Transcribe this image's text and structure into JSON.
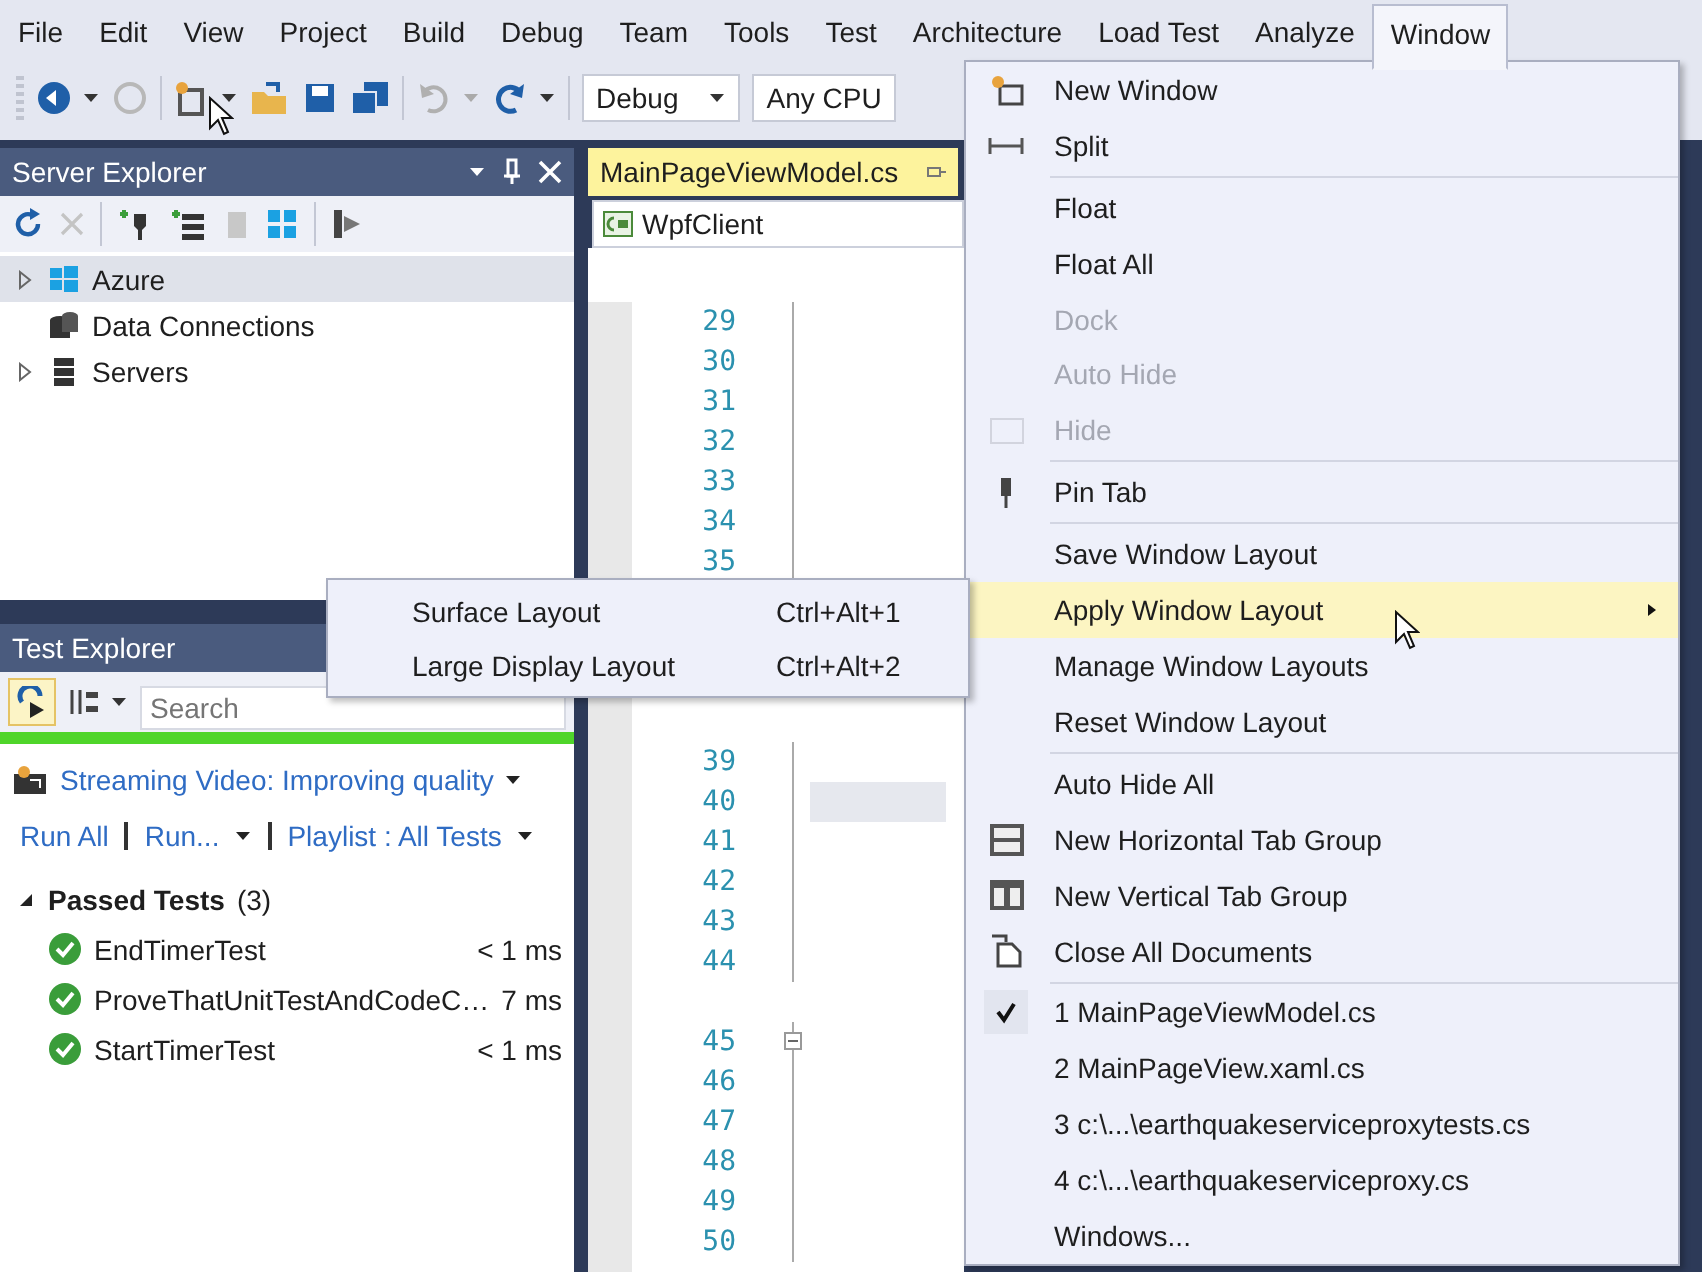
{
  "menubar": [
    {
      "label": "File",
      "selected": false
    },
    {
      "label": "Edit",
      "selected": false
    },
    {
      "label": "View",
      "selected": false
    },
    {
      "label": "Project",
      "selected": false
    },
    {
      "label": "Build",
      "selected": false
    },
    {
      "label": "Debug",
      "selected": false
    },
    {
      "label": "Team",
      "selected": false
    },
    {
      "label": "Tools",
      "selected": false
    },
    {
      "label": "Test",
      "selected": false
    },
    {
      "label": "Architecture",
      "selected": false
    },
    {
      "label": "Load Test",
      "selected": false
    },
    {
      "label": "Analyze",
      "selected": false
    },
    {
      "label": "Window",
      "selected": true
    }
  ],
  "toolbar": {
    "configuration": "Debug",
    "platform": "Any CPU"
  },
  "server_explorer": {
    "title": "Server Explorer",
    "tree": [
      {
        "label": "Azure",
        "kind": "azure",
        "has_children": true,
        "expanded": false,
        "selected": true
      },
      {
        "label": "Data Connections",
        "kind": "database",
        "has_children": false,
        "expanded": false,
        "selected": false
      },
      {
        "label": "Servers",
        "kind": "servers",
        "has_children": true,
        "expanded": false,
        "selected": false
      }
    ]
  },
  "test_explorer": {
    "title": "Test Explorer",
    "search": {
      "placeholder": "Search"
    },
    "progress": {
      "level": 1
    },
    "playlist": "Streaming Video: Improving quality",
    "links": [
      {
        "label": "Run All",
        "dropdown": false
      },
      {
        "label": "Run...",
        "dropdown": true
      },
      {
        "label": "Playlist : All Tests",
        "dropdown": true
      }
    ],
    "group": {
      "label": "Passed Tests",
      "count": "(3)",
      "expanded": true
    },
    "tests": [
      {
        "name": "EndTimerTest",
        "duration": "< 1 ms"
      },
      {
        "name": "ProveThatUnitTestAndCodeC…",
        "duration": "7 ms"
      },
      {
        "name": "StartTimerTest",
        "duration": "< 1 ms"
      }
    ]
  },
  "editor": {
    "tab": "MainPageViewModel.cs",
    "project": "WpfClient",
    "lines": [
      {
        "kind": "line",
        "number": "29",
        "fold": false,
        "highlighted": false
      },
      {
        "kind": "line",
        "number": "30",
        "fold": false,
        "highlighted": false
      },
      {
        "kind": "line",
        "number": "31",
        "fold": false,
        "highlighted": false
      },
      {
        "kind": "line",
        "number": "32",
        "fold": false,
        "highlighted": false
      },
      {
        "kind": "line",
        "number": "33",
        "fold": false,
        "highlighted": false
      },
      {
        "kind": "line",
        "number": "34",
        "fold": false,
        "highlighted": false
      },
      {
        "kind": "line",
        "number": "35",
        "fold": false,
        "highlighted": false
      },
      {
        "kind": "spacer"
      },
      {
        "kind": "spacer"
      },
      {
        "kind": "spacer"
      },
      {
        "kind": "spacer"
      },
      {
        "kind": "line",
        "number": "39",
        "fold": false,
        "highlighted": false
      },
      {
        "kind": "line",
        "number": "40",
        "fold": false,
        "highlighted": true
      },
      {
        "kind": "line",
        "number": "41",
        "fold": false,
        "highlighted": false
      },
      {
        "kind": "line",
        "number": "42",
        "fold": false,
        "highlighted": false
      },
      {
        "kind": "line",
        "number": "43",
        "fold": false,
        "highlighted": false
      },
      {
        "kind": "line",
        "number": "44",
        "fold": false,
        "highlighted": false
      },
      {
        "kind": "spacer"
      },
      {
        "kind": "line",
        "number": "45",
        "fold": true,
        "highlighted": false
      },
      {
        "kind": "line",
        "number": "46",
        "fold": false,
        "highlighted": false
      },
      {
        "kind": "line",
        "number": "47",
        "fold": false,
        "highlighted": false
      },
      {
        "kind": "line",
        "number": "48",
        "fold": false,
        "highlighted": false
      },
      {
        "kind": "line",
        "number": "49",
        "fold": false,
        "highlighted": false
      },
      {
        "kind": "line",
        "number": "50",
        "fold": false,
        "highlighted": false
      }
    ]
  },
  "window_menu": {
    "groups": [
      [
        {
          "label": "New Window",
          "kind": "new-window",
          "disabled": false,
          "checked": false,
          "highlighted": false,
          "submenu": false
        },
        {
          "label": "Split",
          "kind": "split",
          "disabled": false,
          "checked": false,
          "highlighted": false,
          "submenu": false
        }
      ],
      [
        {
          "label": "Float",
          "kind": "plain",
          "disabled": false,
          "checked": false,
          "highlighted": false,
          "submenu": false
        },
        {
          "label": "Float All",
          "kind": "plain",
          "disabled": false,
          "checked": false,
          "highlighted": false,
          "submenu": false
        },
        {
          "label": "Dock",
          "kind": "plain",
          "disabled": true,
          "checked": false,
          "highlighted": false,
          "submenu": false
        },
        {
          "label": "Auto Hide",
          "kind": "plain",
          "disabled": true,
          "checked": false,
          "highlighted": false,
          "submenu": false
        },
        {
          "label": "Hide",
          "kind": "hide",
          "disabled": true,
          "checked": false,
          "highlighted": false,
          "submenu": false
        }
      ],
      [
        {
          "label": "Pin Tab",
          "kind": "pin",
          "disabled": false,
          "checked": false,
          "highlighted": false,
          "submenu": false
        }
      ],
      [
        {
          "label": "Save Window Layout",
          "kind": "plain",
          "disabled": false,
          "checked": false,
          "highlighted": false,
          "submenu": false
        },
        {
          "label": "Apply Window Layout",
          "kind": "plain",
          "disabled": false,
          "checked": false,
          "highlighted": true,
          "submenu": true
        },
        {
          "label": "Manage Window Layouts",
          "kind": "plain",
          "disabled": false,
          "checked": false,
          "highlighted": false,
          "submenu": false
        },
        {
          "label": "Reset Window Layout",
          "kind": "plain",
          "disabled": false,
          "checked": false,
          "highlighted": false,
          "submenu": false
        }
      ],
      [
        {
          "label": "Auto Hide All",
          "kind": "plain",
          "disabled": false,
          "checked": false,
          "highlighted": false,
          "submenu": false
        },
        {
          "label": "New Horizontal Tab Group",
          "kind": "horizontal-group",
          "disabled": false,
          "checked": false,
          "highlighted": false,
          "submenu": false
        },
        {
          "label": "New Vertical Tab Group",
          "kind": "vertical-group",
          "disabled": false,
          "checked": false,
          "highlighted": false,
          "submenu": false
        },
        {
          "label": "Close All Documents",
          "kind": "close-all",
          "disabled": false,
          "checked": false,
          "highlighted": false,
          "submenu": false
        }
      ],
      [
        {
          "label": "1 MainPageViewModel.cs",
          "kind": "plain",
          "disabled": false,
          "checked": true,
          "highlighted": false,
          "submenu": false
        },
        {
          "label": "2 MainPageView.xaml.cs",
          "kind": "plain",
          "disabled": false,
          "checked": false,
          "highlighted": false,
          "submenu": false
        },
        {
          "label": "3 c:\\...\\earthquakeserviceproxytests.cs",
          "kind": "plain",
          "disabled": false,
          "checked": false,
          "highlighted": false,
          "submenu": false
        },
        {
          "label": "4 c:\\...\\earthquakeserviceproxy.cs",
          "kind": "plain",
          "disabled": false,
          "checked": false,
          "highlighted": false,
          "submenu": false
        },
        {
          "label": "Windows...",
          "kind": "plain",
          "disabled": false,
          "checked": false,
          "highlighted": false,
          "submenu": false
        }
      ]
    ]
  },
  "layout_submenu": [
    {
      "label": "Surface Layout",
      "shortcut": "Ctrl+Alt+1"
    },
    {
      "label": "Large Display Layout",
      "shortcut": "Ctrl+Alt+2"
    }
  ]
}
